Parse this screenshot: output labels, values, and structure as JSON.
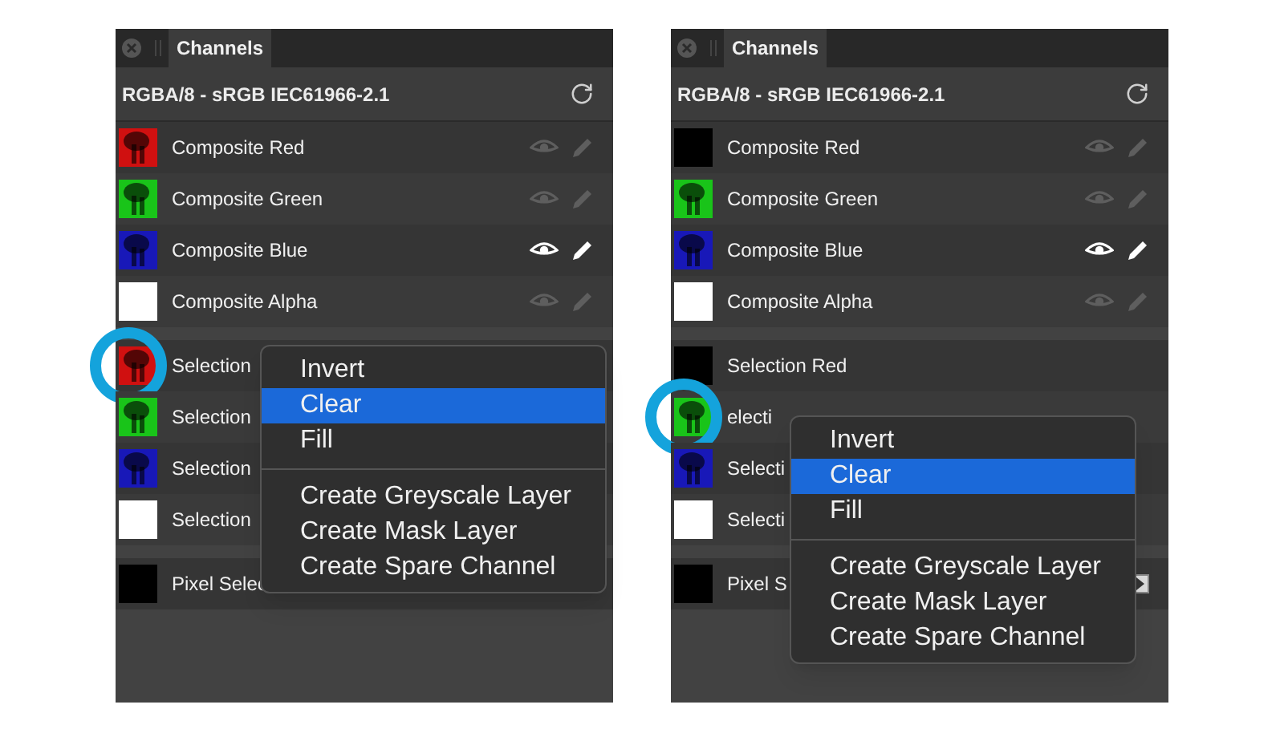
{
  "panels": [
    {
      "tab": {
        "label": "Channels",
        "selected": true
      },
      "format": "RGBA/8 - sRGB IEC61966-2.1",
      "groups": [
        [
          {
            "kind": "composite",
            "name": "Composite Red",
            "active": false,
            "highlighted": false
          },
          {
            "kind": "composite",
            "name": "Composite Green",
            "active": false,
            "highlighted": false
          },
          {
            "kind": "composite",
            "name": "Composite Blue",
            "active": true,
            "highlighted": false
          },
          {
            "kind": "composite",
            "name": "Composite Alpha",
            "thumb": {
              "kind": "plain",
              "color": "#ffffff"
            },
            "active": false,
            "highlighted": false
          }
        ],
        [
          {
            "kind": "selection",
            "name": "Selection",
            "highlighted": true
          },
          {
            "kind": "selection",
            "name": "Selection",
            "highlighted": false
          },
          {
            "kind": "selection",
            "name": "Selection",
            "highlighted": false
          },
          {
            "kind": "selection",
            "name": "Selection",
            "thumb": {
              "kind": "plain",
              "color": "#ffffff"
            },
            "highlighted": false
          }
        ],
        [
          {
            "kind": "selection",
            "name": "Pixel Selec",
            "thumb": {
              "kind": "plain",
              "color": "#000000"
            },
            "highlighted": false
          }
        ]
      ],
      "menu": [
        {
          "kind": "item",
          "label": "Invert",
          "selected": false
        },
        {
          "kind": "item",
          "label": "Clear",
          "selected": true
        },
        {
          "kind": "item",
          "label": "Fill",
          "selected": false
        },
        {
          "kind": "separator"
        },
        {
          "kind": "item",
          "label": "Create Greyscale Layer",
          "selected": false
        },
        {
          "kind": "item",
          "label": "Create Mask Layer",
          "selected": false
        },
        {
          "kind": "item",
          "label": "Create Spare Channel",
          "selected": false
        }
      ]
    },
    {
      "tab": {
        "label": "Channels",
        "selected": true
      },
      "format": "RGBA/8 - sRGB IEC61966-2.1",
      "groups": [
        [
          {
            "kind": "composite",
            "name": "Composite Red",
            "thumb": {
              "kind": "plain",
              "color": "#000000"
            },
            "active": false,
            "highlighted": false
          },
          {
            "kind": "composite",
            "name": "Composite Green",
            "active": false,
            "highlighted": false
          },
          {
            "kind": "composite",
            "name": "Composite Blue",
            "active": true,
            "highlighted": false
          },
          {
            "kind": "composite",
            "name": "Composite Alpha",
            "thumb": {
              "kind": "plain",
              "color": "#ffffff"
            },
            "active": false,
            "highlighted": false
          }
        ],
        [
          {
            "kind": "selection",
            "name": "Selection Red",
            "thumb": {
              "kind": "plain",
              "color": "#000000"
            },
            "highlighted": false
          },
          {
            "kind": "selection",
            "name": "electi",
            "highlighted": true
          },
          {
            "kind": "selection",
            "name": "Selecti",
            "highlighted": false
          },
          {
            "kind": "selection",
            "name": "Selecti",
            "thumb": {
              "kind": "plain",
              "color": "#ffffff"
            },
            "highlighted": false
          }
        ],
        [
          {
            "kind": "pixel",
            "name": "Pixel S",
            "thumb": {
              "kind": "plain",
              "color": "#000000"
            },
            "highlighted": false
          }
        ]
      ],
      "menu": [
        {
          "kind": "item",
          "label": "Invert",
          "selected": false
        },
        {
          "kind": "item",
          "label": "Clear",
          "selected": true
        },
        {
          "kind": "item",
          "label": "Fill",
          "selected": false
        },
        {
          "kind": "separator"
        },
        {
          "kind": "item",
          "label": "Create Greyscale Layer",
          "selected": false
        },
        {
          "kind": "item",
          "label": "Create Mask Layer",
          "selected": false
        },
        {
          "kind": "item",
          "label": "Create Spare Channel",
          "selected": false
        }
      ]
    }
  ]
}
